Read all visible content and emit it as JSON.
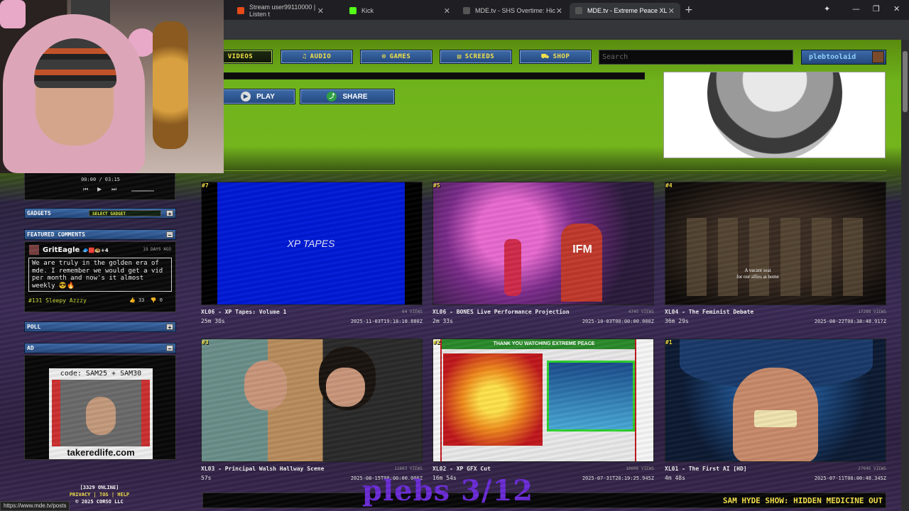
{
  "browser": {
    "tabs": [
      {
        "label": "Stream user99110000 | Listen t",
        "color": "#e64a19"
      },
      {
        "label": "Kick",
        "color": "#53fc18"
      },
      {
        "label": "MDE.tv - SHS Overtime: Hic",
        "color": "#444444"
      },
      {
        "label": "MDE.tv - Extreme Peace XL",
        "color": "#444444"
      }
    ],
    "status_url": "https://www.mde.tv/posts"
  },
  "nav": {
    "videos": "VIDEOS",
    "audio": "AUDIO",
    "games": "GAMES",
    "screeds": "SCREEDS",
    "shop": "SHOP",
    "search_placeholder": "Search",
    "username": "plebtoolaid"
  },
  "player_actions": {
    "play": "PLAY",
    "share": "SHARE"
  },
  "sidebar": {
    "player_time": "00:00 / 03:15",
    "gadgets": {
      "title": "GADGETS",
      "select": "SELECT GADGET"
    },
    "featured": {
      "title": "FEATURED COMMENTS",
      "user": "GritEagle",
      "user_badges": "🧢🟥🧆+4",
      "ago": "19 DAYS AGO",
      "text": "We are truly in the golden era of mde. I remember we would get a vid per month and now's it almost weekly 😎🔥",
      "rank": "#131 Sleepy Azzzy",
      "up": "33",
      "down": "0"
    },
    "poll": {
      "title": "POLL"
    },
    "ad": {
      "title": "AD",
      "code": "code: SAM25 + SAM30",
      "url": "takeredlife.com"
    }
  },
  "videos": [
    {
      "rank": "#7",
      "title": "XL06 - XP Tapes: Volume 1",
      "views": "64 VIEWS",
      "duration": "25m 30s",
      "date": "2025-11-03T19:18:18.880Z",
      "thumb_text": "XP TAPES"
    },
    {
      "rank": "#5",
      "title": "XL06 - BONES Live Performance Projection",
      "views": "4745 VIEWS",
      "duration": "2m 33s",
      "date": "2025-10-03T00:00:00.000Z",
      "thumb_text": "IFM"
    },
    {
      "rank": "#4",
      "title": "XL04 - The Feminist Debate",
      "views": "17288 VIEWS",
      "duration": "36m 29s",
      "date": "2025-08-22T00:38:48.917Z",
      "thumb_text": "A vacant seat\nfor our allies at home"
    },
    {
      "rank": "#3",
      "title": "XL03 - Principal Walsh Hallway Scene",
      "views": "11663 VIEWS",
      "duration": "57s",
      "date": "2025-08-15T00:00:00.000Z",
      "thumb_text": ""
    },
    {
      "rank": "#2",
      "title": "XL02 - XP GFX Cut",
      "views": "10606 VIEWS",
      "duration": "16m 54s",
      "date": "2025-07-31T20:19:25.945Z",
      "thumb_text": "THANK YOU WATCHING EXTREME PEACE"
    },
    {
      "rank": "#1",
      "title": "XL01 - The First AI [HD]",
      "views": "27646 VIEWS",
      "duration": "4m 48s",
      "date": "2025-07-11T00:00:48.345Z",
      "thumb_text": ""
    }
  ],
  "footer": {
    "online": "[3329 ONLINE]",
    "links": "PRIVACY | TOS | HELP",
    "copyright": "© 2025 CORSO LLC"
  },
  "ticker": "SAM HYDE SHOW: HIDDEN MEDICINE OUT",
  "overlay_text": "plebs 3/12",
  "colors": {
    "accent": "#f4e24a",
    "nav_blue": "#2f5b99",
    "green": "#74b51d"
  }
}
